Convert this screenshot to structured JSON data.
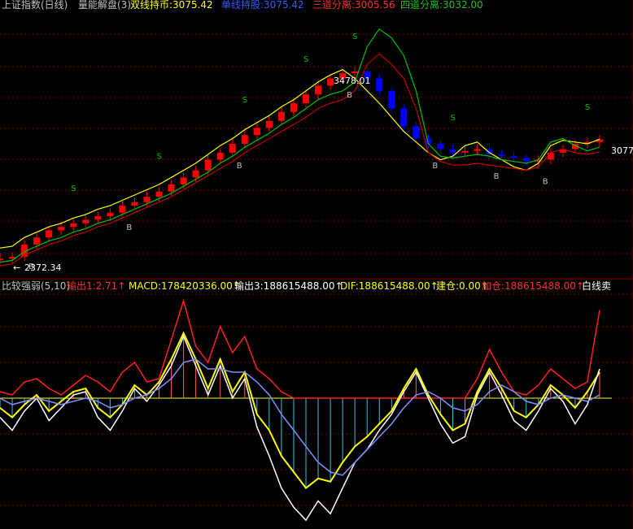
{
  "header_top": {
    "index_name": "上证指数(日线)",
    "indicator_name": "量能解盘(3)",
    "items": [
      {
        "label": "双线持币:",
        "value": "3075.42",
        "color": "#ffff00"
      },
      {
        "label": "单线持股:",
        "value": "3075.42",
        "color": "#2f5cff"
      },
      {
        "label": "三道分离:",
        "value": "3005.56",
        "color": "#ff3030"
      },
      {
        "label": "四道分离:",
        "value": "3032.00",
        "color": "#20c020"
      }
    ]
  },
  "header_bottom": {
    "name": "比较强弱(5,10)",
    "items": [
      {
        "label": "输出1:",
        "value": "2.71",
        "arrow": "↑",
        "color": "#ff3030"
      },
      {
        "label": "MACD:",
        "value": "178420336.00",
        "arrow": "↑",
        "color": "#ffff00"
      },
      {
        "label": "输出3:",
        "value": "188615488.00",
        "arrow": "↑",
        "color": "#ffffff"
      },
      {
        "label": "DIF:",
        "value": "188615488.00",
        "arrow": "↑",
        "color": "#ffff00"
      },
      {
        "label": "建仓:",
        "value": "0.00",
        "arrow": "↑",
        "color": "#ffff00"
      },
      {
        "label": "加仓:",
        "value": "188615488.00",
        "arrow": "↑",
        "color": "#ff3030"
      }
    ],
    "tail": "白线卖"
  },
  "annotations": {
    "high_price": "3478.01",
    "low_price": "2372.34",
    "last_price": "3077",
    "sell_marker": "S",
    "buy_marker": "B"
  },
  "colors": {
    "background": "#000000",
    "grid": "#8b0000",
    "up_candle": "#ff0000",
    "down_candle": "#0000ff",
    "signal_candle": "#ff00ff",
    "green_line": "#00c000",
    "red_line": "#c00000",
    "yellow_line": "#ffff00",
    "blue_line": "#7f8fff",
    "white_line": "#ffffff"
  },
  "chart_data": [
    {
      "type": "line",
      "title": "上证指数(日线) 量能解盘(3)",
      "ylim": [
        2300,
        3800
      ],
      "x": [
        0,
        3,
        6,
        9,
        12,
        15,
        18,
        21,
        24,
        27,
        30,
        33,
        36,
        39,
        42,
        45,
        48,
        51,
        54,
        57,
        60,
        63,
        66,
        69,
        72,
        75,
        78,
        81,
        84,
        87,
        90,
        93,
        96,
        99,
        102,
        105,
        108,
        111,
        114,
        117,
        120,
        123,
        126,
        129,
        132,
        135,
        138,
        141,
        144,
        147
      ],
      "series": [
        {
          "name": "单线持股",
          "values": [
            2400,
            2410,
            2480,
            2520,
            2560,
            2580,
            2600,
            2620,
            2640,
            2660,
            2700,
            2720,
            2750,
            2780,
            2820,
            2860,
            2900,
            2960,
            3000,
            3050,
            3100,
            3140,
            3180,
            3230,
            3280,
            3330,
            3380,
            3420,
            3450,
            3460,
            3420,
            3350,
            3250,
            3150,
            3080,
            3050,
            3020,
            3000,
            3010,
            3020,
            2990,
            2980,
            2970,
            2950,
            2960,
            3000,
            3020,
            3050,
            3060,
            3075
          ]
        },
        {
          "name": "双线持币",
          "values": [
            2460,
            2470,
            2520,
            2550,
            2580,
            2600,
            2630,
            2650,
            2680,
            2700,
            2730,
            2760,
            2790,
            2820,
            2860,
            2900,
            2940,
            2990,
            3040,
            3080,
            3130,
            3170,
            3210,
            3260,
            3300,
            3350,
            3400,
            3440,
            3470,
            3420,
            3350,
            3280,
            3200,
            3120,
            3060,
            3000,
            2960,
            2980,
            3040,
            3060,
            3000,
            2960,
            2920,
            2900,
            2940,
            3040,
            3070,
            3060,
            3050,
            3076
          ]
        },
        {
          "name": "四道分离",
          "values": [
            2380,
            2390,
            2440,
            2470,
            2500,
            2520,
            2550,
            2570,
            2600,
            2620,
            2650,
            2680,
            2710,
            2740,
            2770,
            2810,
            2850,
            2890,
            2940,
            2980,
            3030,
            3070,
            3110,
            3160,
            3200,
            3250,
            3300,
            3330,
            3350,
            3400,
            3600,
            3700,
            3650,
            3550,
            3350,
            3050,
            2980,
            2970,
            2980,
            2990,
            2980,
            2960,
            2950,
            2940,
            2960,
            3060,
            3080,
            3040,
            3010,
            3032
          ]
        },
        {
          "name": "三道分离",
          "values": [
            2360,
            2370,
            2420,
            2450,
            2480,
            2500,
            2530,
            2550,
            2580,
            2600,
            2630,
            2660,
            2690,
            2720,
            2750,
            2790,
            2830,
            2870,
            2910,
            2950,
            3000,
            3040,
            3080,
            3120,
            3160,
            3200,
            3250,
            3280,
            3300,
            3350,
            3500,
            3560,
            3500,
            3420,
            3250,
            3000,
            2950,
            2930,
            2930,
            2940,
            2930,
            2920,
            2910,
            2900,
            2920,
            3000,
            3020,
            3000,
            2990,
            3005
          ]
        }
      ]
    },
    {
      "type": "line",
      "title": "比较强弱(5,10)",
      "x": [
        0,
        3,
        6,
        9,
        12,
        15,
        18,
        21,
        24,
        27,
        30,
        33,
        36,
        39,
        42,
        45,
        48,
        51,
        54,
        57,
        60,
        63,
        66,
        69,
        72,
        75,
        78,
        81,
        84,
        87,
        90,
        93,
        96,
        99,
        102,
        105,
        108,
        111,
        114,
        117,
        120,
        123,
        126,
        129,
        132,
        135,
        138,
        141,
        144,
        147
      ],
      "series": [
        {
          "name": "输出1",
          "values": [
            0.2,
            0.1,
            0.5,
            0.6,
            0.3,
            0.1,
            0.4,
            0.7,
            0.5,
            0.2,
            0.8,
            1.1,
            0.5,
            0.6,
            1.8,
            3.0,
            1.6,
            1.1,
            2.2,
            1.4,
            1.9,
            0.9,
            0.6,
            0.2,
            0,
            0,
            0,
            0,
            0,
            0,
            0,
            0,
            0,
            0,
            0,
            0,
            0,
            0,
            0,
            0.6,
            1.5,
            0.8,
            0.2,
            0.1,
            0.4,
            0.9,
            0.6,
            0.3,
            0.5,
            2.71
          ]
        },
        {
          "name": "MACD",
          "values": [
            -0.3,
            -0.6,
            -0.2,
            0.1,
            -0.4,
            -0.1,
            0.2,
            0.3,
            -0.3,
            -0.6,
            -0.2,
            0.4,
            0.1,
            0.5,
            1.2,
            2.0,
            1.2,
            0.3,
            1.2,
            0.2,
            0.8,
            -0.5,
            -1.0,
            -1.8,
            -2.3,
            -2.8,
            -2.5,
            -2.6,
            -2.0,
            -1.5,
            -1.2,
            -0.8,
            -0.4,
            0.3,
            0.9,
            0.1,
            -0.5,
            -1.0,
            -0.8,
            0.2,
            0.9,
            0.3,
            -0.4,
            -0.6,
            -0.2,
            0.4,
            0.1,
            -0.3,
            0.2,
            0.8
          ]
        },
        {
          "name": "输出3",
          "values": [
            -0.6,
            -1.0,
            -0.4,
            0.0,
            -0.7,
            -0.3,
            0.1,
            0.2,
            -0.6,
            -1.0,
            -0.4,
            0.3,
            -0.1,
            0.4,
            1.0,
            1.9,
            1.0,
            0.1,
            1.0,
            0.0,
            0.6,
            -0.9,
            -1.8,
            -2.8,
            -3.4,
            -3.8,
            -3.2,
            -3.6,
            -2.8,
            -2.0,
            -1.6,
            -1.0,
            -0.5,
            0.2,
            0.8,
            0.0,
            -0.8,
            -1.4,
            -1.2,
            0.1,
            0.8,
            0.1,
            -0.7,
            -1.0,
            -0.4,
            0.3,
            -0.1,
            -0.8,
            -0.2,
            0.9
          ]
        },
        {
          "name": "DIF",
          "values": [
            0.0,
            -0.2,
            -0.1,
            0.0,
            -0.1,
            -0.2,
            -0.1,
            0.0,
            -0.1,
            -0.3,
            -0.2,
            0.0,
            0.1,
            0.3,
            0.6,
            1.1,
            1.2,
            0.9,
            0.9,
            0.8,
            0.8,
            0.5,
            0.1,
            -0.5,
            -1.0,
            -1.5,
            -2.0,
            -2.3,
            -2.4,
            -2.0,
            -1.6,
            -1.2,
            -0.8,
            -0.3,
            0.1,
            0.2,
            0.0,
            -0.3,
            -0.4,
            -0.2,
            0.2,
            0.4,
            0.2,
            -0.1,
            -0.2,
            0.0,
            0.1,
            0.0,
            -0.1,
            0.1
          ]
        }
      ]
    }
  ]
}
